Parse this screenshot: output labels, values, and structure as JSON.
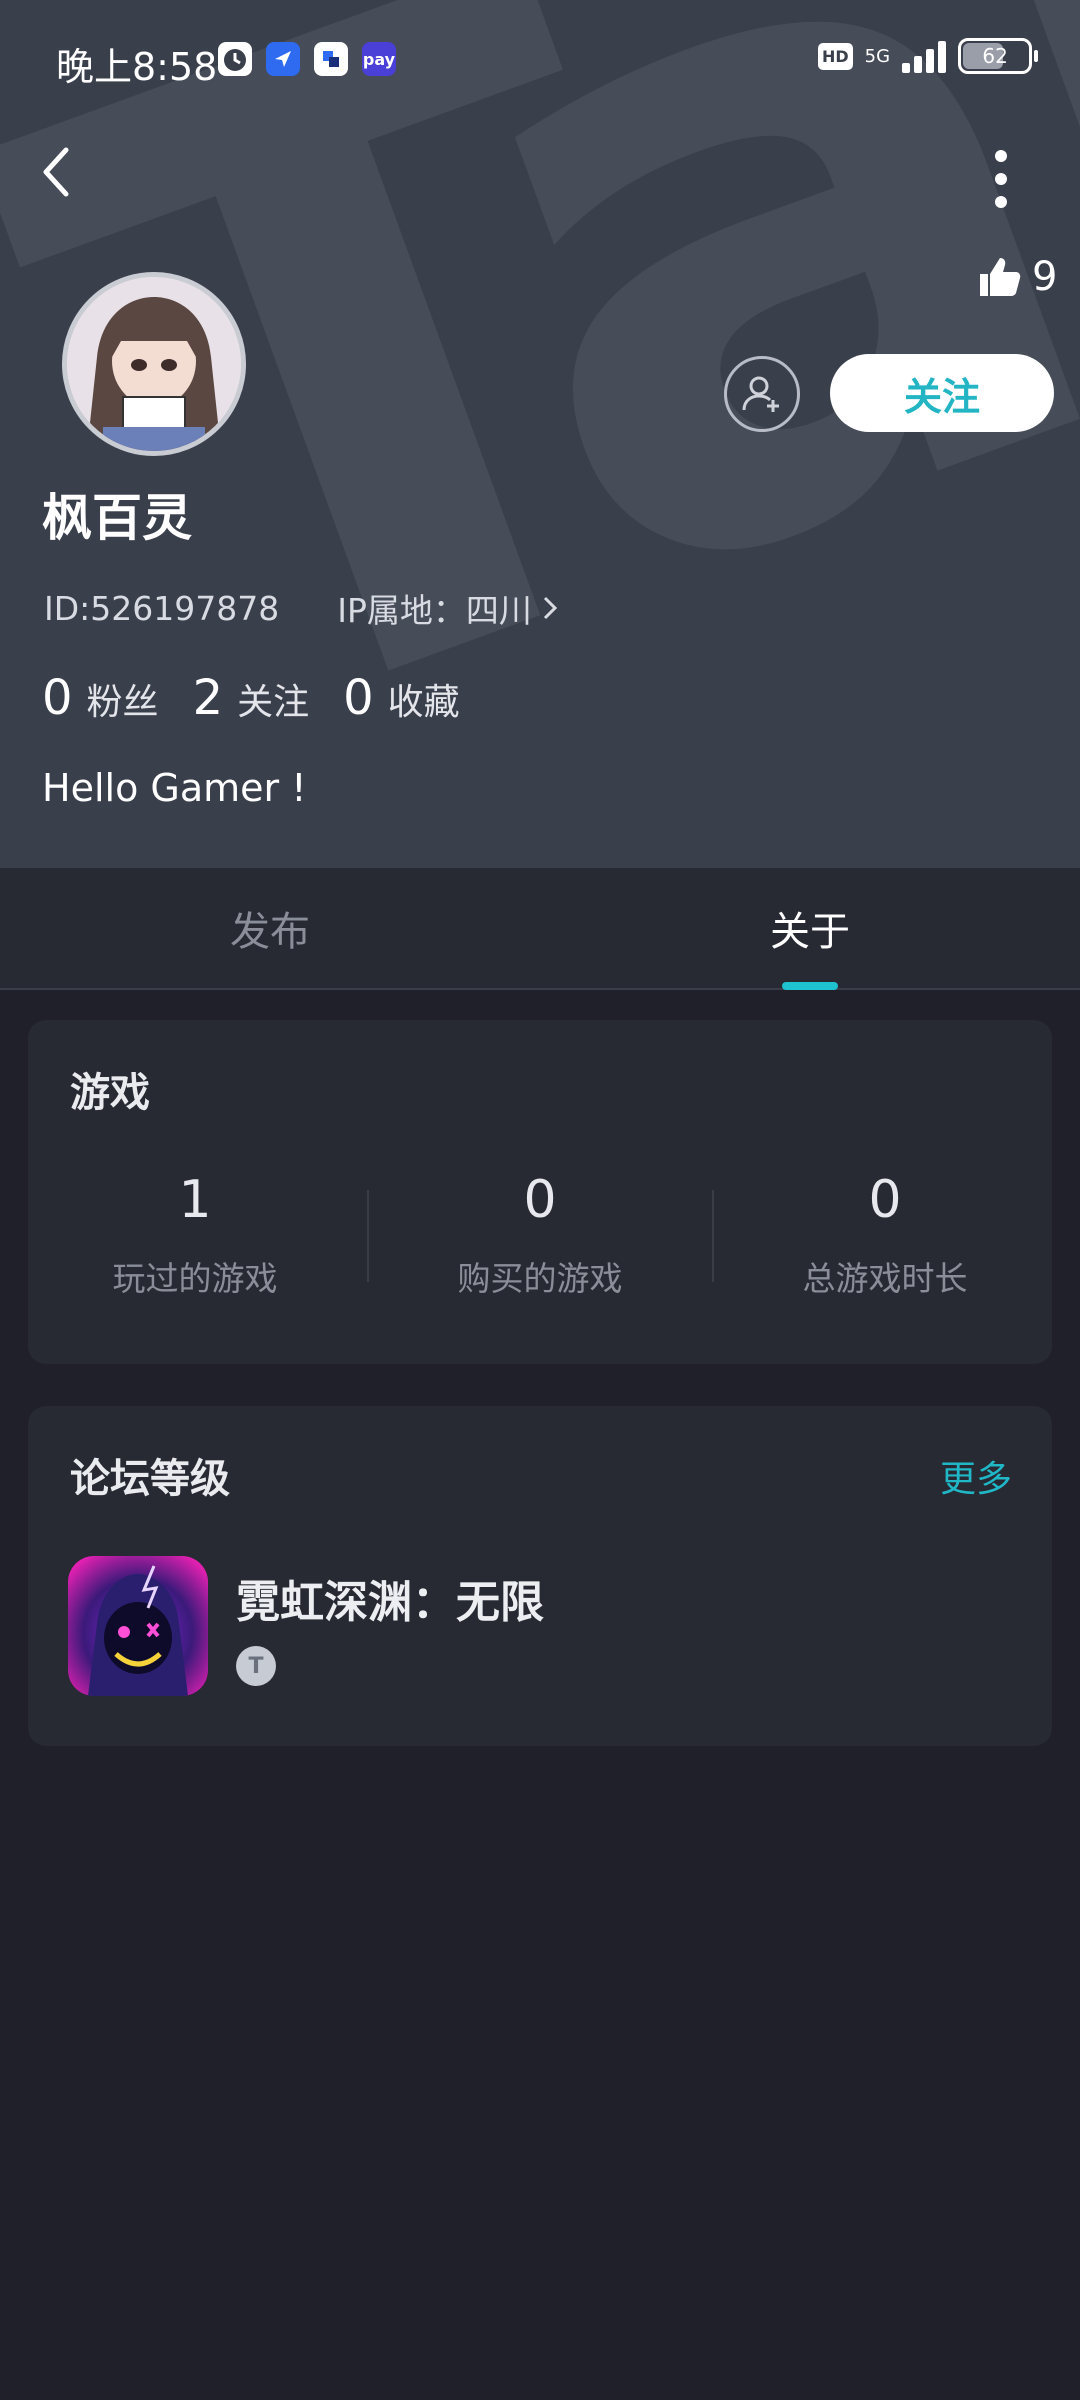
{
  "status_bar": {
    "time": "晚上8:58",
    "hd": "HD",
    "network": "5G",
    "battery": "62"
  },
  "profile": {
    "name": "枫百灵",
    "id": "ID:526197878",
    "ip_location": "IP属地：四川",
    "likes": "9",
    "follow_button": "关注",
    "stats": [
      {
        "count": "0",
        "label": "粉丝"
      },
      {
        "count": "2",
        "label": "关注"
      },
      {
        "count": "0",
        "label": "收藏"
      }
    ],
    "bio": "Hello Gamer !"
  },
  "tabs": [
    {
      "label": "发布",
      "active": false
    },
    {
      "label": "关于",
      "active": true
    }
  ],
  "games_card": {
    "title": "游戏",
    "stats": [
      {
        "value": "1",
        "label": "玩过的游戏"
      },
      {
        "value": "0",
        "label": "购买的游戏"
      },
      {
        "value": "0",
        "label": "总游戏时长"
      }
    ]
  },
  "forum_card": {
    "title": "论坛等级",
    "more": "更多",
    "game_name": "霓虹深渊：无限",
    "level_badge": "T"
  },
  "colors": {
    "accent": "#1fc3cf",
    "header_bg": "#3a3f4c",
    "page_bg": "#1f2029",
    "card_bg": "#272933"
  }
}
